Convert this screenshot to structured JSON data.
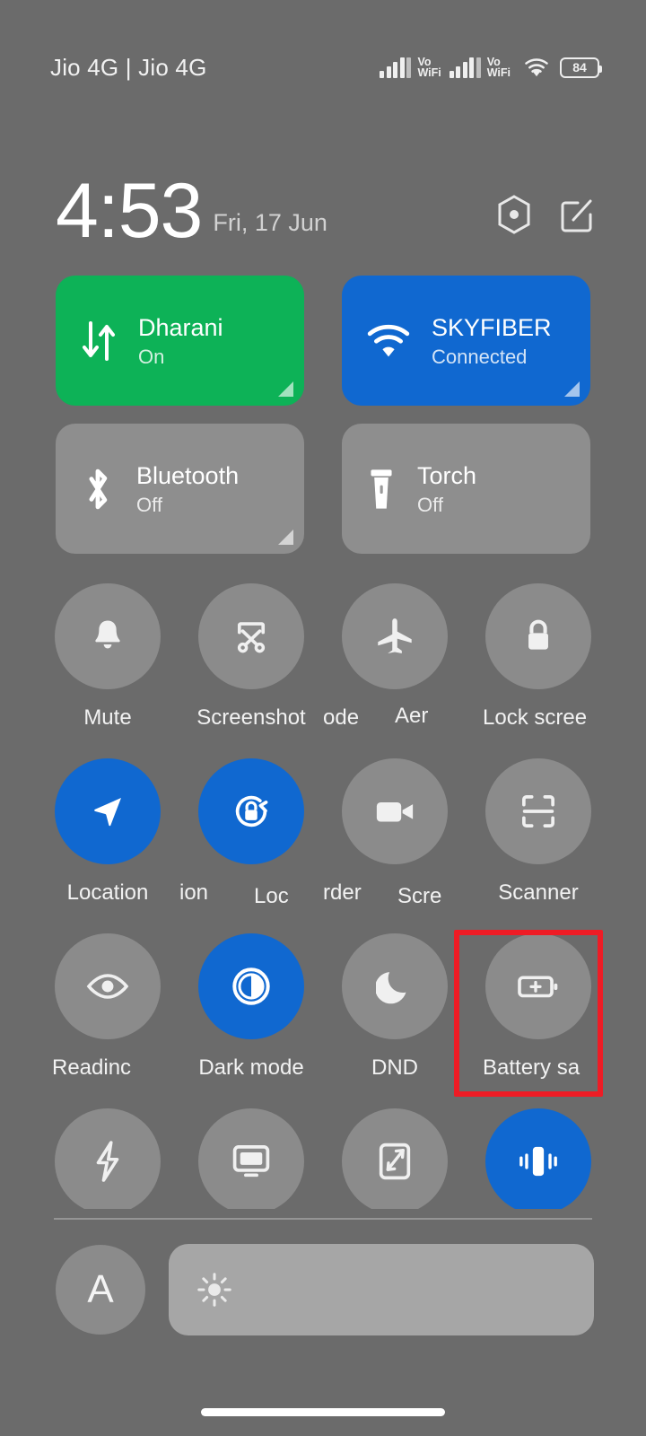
{
  "status_bar": {
    "carrier": "Jio 4G | Jio 4G",
    "vowifi_1": "Vo\nWiFi",
    "vowifi_2": "Vo\nWiFi",
    "battery_percent": "84",
    "icons": [
      "signal-bars-icon",
      "vowifi-icon",
      "signal-bars-icon",
      "vowifi-icon",
      "wifi-icon",
      "battery-icon"
    ]
  },
  "clock": {
    "time": "4:53",
    "date": "Fri, 17 Jun",
    "settings_icon": "settings-gear-icon",
    "edit_icon": "edit-tiles-icon"
  },
  "big_tiles": [
    {
      "name": "mobile-data",
      "title": "Dharani",
      "subtitle": "On",
      "state": "on",
      "color": "#0db257",
      "icon": "data-transfer-icon",
      "has_expand": true
    },
    {
      "name": "wifi",
      "title": "SKYFIBER",
      "subtitle": "Connected",
      "state": "on",
      "color": "#1068d0",
      "icon": "wifi-icon",
      "has_expand": true
    },
    {
      "name": "bluetooth",
      "title": "Bluetooth",
      "subtitle": "Off",
      "state": "off",
      "color": "#9a9a9a",
      "icon": "bluetooth-icon",
      "has_expand": true
    },
    {
      "name": "torch",
      "title": "Torch",
      "subtitle": "Off",
      "state": "off",
      "color": "#9a9a9a",
      "icon": "torch-icon",
      "has_expand": false
    }
  ],
  "toggle_rows": [
    {
      "tiles": [
        {
          "name": "mute",
          "label": "Mute",
          "state": "off",
          "icon": "bell-icon"
        },
        {
          "name": "screenshot",
          "label": "Screenshot",
          "state": "off",
          "icon": "screenshot-scissors-icon"
        },
        {
          "name": "aeroplane-mode",
          "label": "ode",
          "state": "off",
          "icon": "aeroplane-icon"
        },
        {
          "name": "lock-screen",
          "label": "Lock scree",
          "state": "off",
          "icon": "padlock-icon"
        }
      ]
    },
    {
      "tiles": [
        {
          "name": "location",
          "label": "Location",
          "state": "on",
          "icon": "location-arrow-icon"
        },
        {
          "name": "rotation-lock",
          "label": "ion",
          "state": "on",
          "icon": "rotation-lock-icon"
        },
        {
          "name": "screen-recorder",
          "label": "rder",
          "state": "off",
          "icon": "video-camera-icon"
        },
        {
          "name": "scanner",
          "label": "Scanner",
          "state": "off",
          "icon": "qr-scanner-icon"
        }
      ]
    },
    {
      "tiles": [
        {
          "name": "reading-mode",
          "label": "Readinc",
          "state": "off",
          "icon": "eye-icon"
        },
        {
          "name": "dark-mode",
          "label": "Dark mode",
          "state": "on",
          "icon": "contrast-circle-icon"
        },
        {
          "name": "dnd",
          "label": "DND",
          "state": "off",
          "icon": "moon-icon"
        },
        {
          "name": "battery-saver",
          "label": "Battery sa",
          "state": "off",
          "icon": "battery-plus-icon",
          "highlighted": true
        }
      ]
    },
    {
      "tiles": [
        {
          "name": "power-saving",
          "label": "",
          "state": "off",
          "icon": "lightning-bolt-icon"
        },
        {
          "name": "cast",
          "label": "",
          "state": "off",
          "icon": "monitor-cast-icon"
        },
        {
          "name": "full-screen",
          "label": "",
          "state": "off",
          "icon": "expand-arrows-icon"
        },
        {
          "name": "vibrate",
          "label": "",
          "state": "on",
          "icon": "vibrate-icon"
        }
      ]
    }
  ],
  "marquee_extras": {
    "aeroplane_tail": "Aer",
    "rotation_tail": "Loc",
    "recorder_tail": "Scre"
  },
  "brightness": {
    "auto_label": "A",
    "slider_icon": "sun-brightness-icon",
    "slider_level_percent": 5
  },
  "navigation": {
    "home_bar": "home-gesture-bar"
  },
  "colors": {
    "background": "#6b6b6b",
    "accent_blue": "#1068d0",
    "accent_green": "#0db257",
    "tile_inactive": "rgba(255,255,255,.22)",
    "highlight_red": "#ee1c25"
  }
}
